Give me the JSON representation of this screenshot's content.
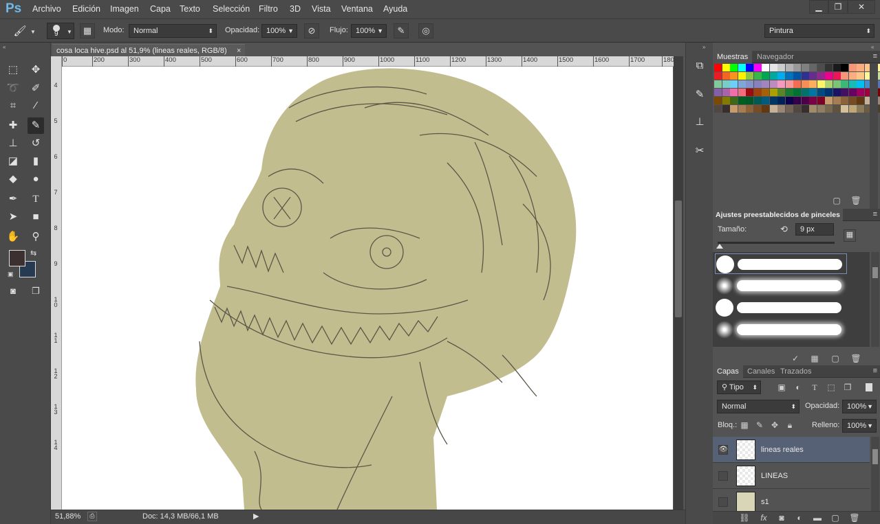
{
  "app": {
    "logo": "Ps"
  },
  "menu": [
    "Archivo",
    "Edición",
    "Imagen",
    "Capa",
    "Texto",
    "Selección",
    "Filtro",
    "3D",
    "Vista",
    "Ventana",
    "Ayuda"
  ],
  "window_controls": {
    "minimize": "▁",
    "restore": "❐",
    "close": "✕"
  },
  "options": {
    "brush_size": "9",
    "mode_label": "Modo:",
    "mode_value": "Normal",
    "opacity_label": "Opacidad:",
    "opacity_value": "100%",
    "flow_label": "Flujo:",
    "flow_value": "100%",
    "workspace": "Pintura"
  },
  "document": {
    "tab_title": "cosa loca hive.psd al 51,9% (lineas reales, RGB/8)",
    "close": "×",
    "ruler_top": [
      "0",
      "200",
      "300",
      "400",
      "500",
      "600",
      "700",
      "800",
      "900",
      "1000",
      "1100",
      "1200",
      "1300",
      "1400",
      "1500",
      "1600",
      "1700",
      "180"
    ],
    "ruler_left": [
      "4",
      "5",
      "6",
      "7",
      "8",
      "9",
      "1 0",
      "1 1",
      "1 2",
      "1 3",
      "1 4"
    ]
  },
  "status": {
    "zoom": "51,88%",
    "doc_info": "Doc: 14,3 MB/66,1 MB"
  },
  "colors": {
    "foreground": "#3d3030",
    "background": "#263a52",
    "skin": "#c2bd8f",
    "line": "#5b5646"
  },
  "swatches_panel": {
    "tab_active": "Muestras",
    "tab_other": "Navegador"
  },
  "brush_presets": {
    "title": "Ajustes preestablecidos de pinceles",
    "size_label": "Tamaño:",
    "size_value": "9 px",
    "slider_fraction": 0.02
  },
  "layers_panel": {
    "tabs": [
      "Capas",
      "Canales",
      "Trazados"
    ],
    "filter": "Tipo",
    "blend_mode": "Normal",
    "opacity_label": "Opacidad:",
    "opacity_value": "100%",
    "lock_label": "Bloq.:",
    "fill_label": "Relleno:",
    "fill_value": "100%",
    "layers": [
      {
        "name": "lineas reales",
        "visible": true,
        "selected": true
      },
      {
        "name": "LINEAS",
        "visible": false,
        "selected": false
      },
      {
        "name": "s1",
        "visible": false,
        "selected": false
      }
    ]
  }
}
